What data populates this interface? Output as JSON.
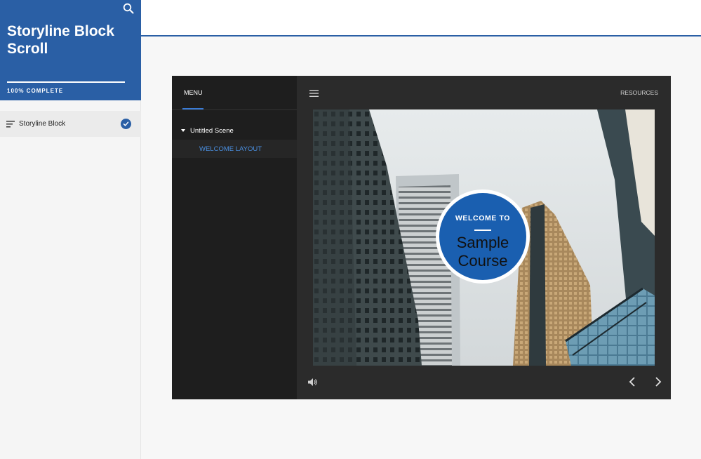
{
  "sidebar": {
    "course_title": "Storyline Block Scroll",
    "progress_label": "100% COMPLETE",
    "progress_fraction": 1.0,
    "lessons": [
      {
        "label": "Storyline Block",
        "completed": true
      }
    ]
  },
  "player": {
    "menu_tab_label": "MENU",
    "scenes": [
      {
        "label": "Untitled Scene",
        "slides": [
          {
            "label": "WELCOME LAYOUT"
          }
        ]
      }
    ],
    "resources_label": "RESOURCES",
    "slide": {
      "welcome_text": "WELCOME TO",
      "course_name": "Sample Course"
    }
  },
  "colors": {
    "brand_blue": "#2a5fa5",
    "badge_blue": "#1a5fb0",
    "active_slide_text": "#4a8fe0"
  },
  "icons": [
    "search-icon",
    "lesson-list-icon",
    "check-icon",
    "caret-down-icon",
    "hamburger-icon",
    "volume-icon",
    "chevron-left-icon",
    "chevron-right-icon"
  ]
}
